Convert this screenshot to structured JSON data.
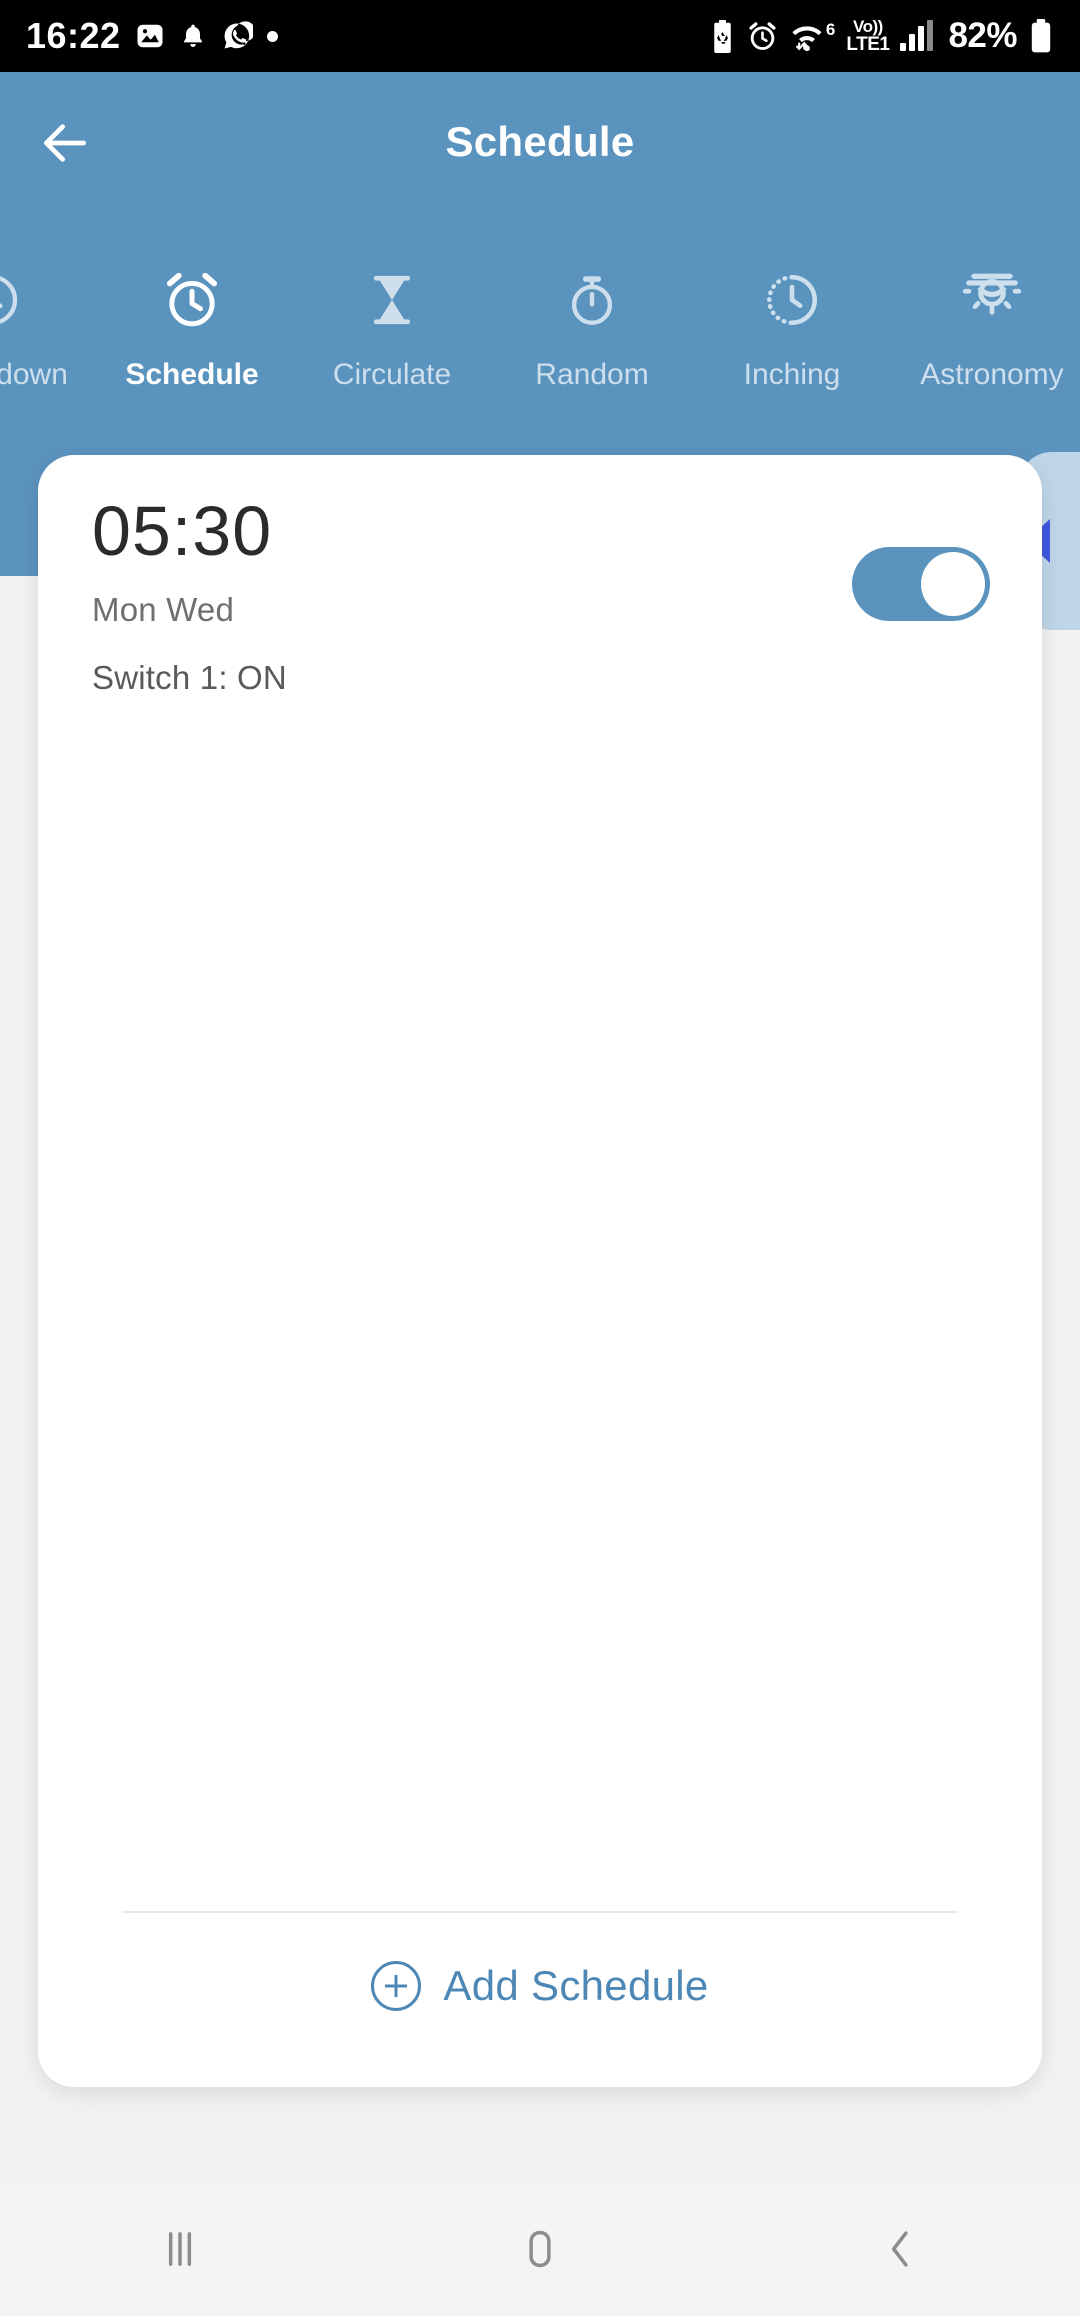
{
  "status_bar": {
    "clock": "16:22",
    "battery_percent": "82%",
    "network_label_top": "Vo))",
    "network_label_bottom": "LTE1",
    "wifi_generation": "6",
    "left_icons": [
      "photo-icon",
      "bell-icon",
      "whatsapp-icon",
      "dot-icon"
    ],
    "right_icons": [
      "battery-saver-icon",
      "alarm-icon",
      "wifi-icon",
      "volte-icon",
      "signal-bars-icon",
      "battery-icon"
    ]
  },
  "header": {
    "title": "Schedule",
    "back_icon": "arrow-left-icon",
    "background_color": "#5b93bf"
  },
  "tabs": [
    {
      "label": "Countdown",
      "icon": "clock-icon",
      "active": false,
      "partial": true
    },
    {
      "label": "Schedule",
      "icon": "alarm-clock-icon",
      "active": true,
      "partial": false
    },
    {
      "label": "Circulate",
      "icon": "hourglass-icon",
      "active": false,
      "partial": false
    },
    {
      "label": "Random",
      "icon": "stopwatch-icon",
      "active": false,
      "partial": false
    },
    {
      "label": "Inching",
      "icon": "dotted-clock-icon",
      "active": false,
      "partial": false
    },
    {
      "label": "Astronomy",
      "icon": "sun-lamp-icon",
      "active": false,
      "partial": false
    }
  ],
  "side_tab": {
    "icon": "triangle-left-icon",
    "arrow_color": "#4158e0",
    "background_color": "#bed6e8"
  },
  "card": {
    "schedules": [
      {
        "time": "05:30",
        "days": "Mon Wed",
        "switch_state": "Switch 1: ON",
        "enabled": true
      }
    ],
    "footer": {
      "add_label": "Add Schedule",
      "add_icon": "plus-circle-icon",
      "accent_color": "#4d87b5"
    }
  },
  "nav_bar": {
    "buttons": [
      {
        "name": "recents",
        "icon": "recents-icon"
      },
      {
        "name": "home",
        "icon": "home-icon"
      },
      {
        "name": "back",
        "icon": "chevron-left-icon"
      }
    ]
  }
}
